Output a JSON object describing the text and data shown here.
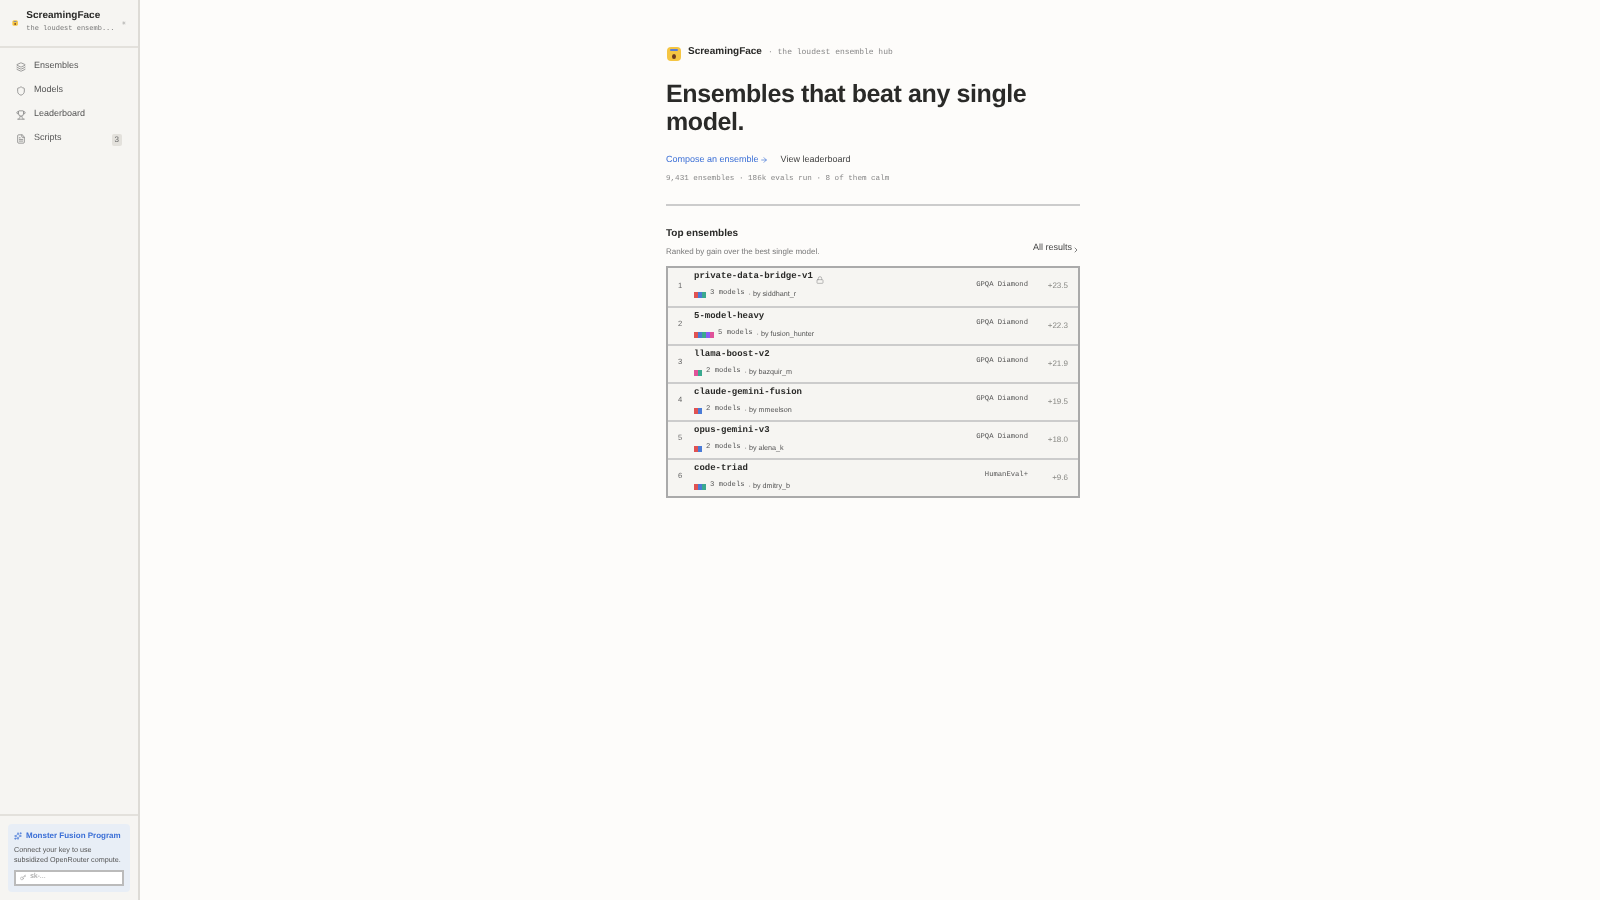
{
  "sidebar": {
    "brand": "ScreamingFace",
    "tagline": "the loudest ensemb...",
    "items": [
      {
        "label": "Ensembles",
        "selected": false
      },
      {
        "label": "Models",
        "selected": false
      },
      {
        "label": "Leaderboard",
        "selected": false
      },
      {
        "label": "Scripts",
        "selected": false,
        "badge": "3"
      }
    ],
    "promo": {
      "title": "Monster Fusion Program",
      "text": "Connect your key to use subsidized OpenRouter compute.",
      "placeholder": "sk-..."
    }
  },
  "header": {
    "brand": "ScreamingFace",
    "tagline": "· the loudest ensemble hub"
  },
  "hero": {
    "title": "Ensembles that beat any single model.",
    "primary_link": "Compose an ensemble",
    "secondary_link": "View leaderboard",
    "stats": "9,431 ensembles · 186k evals run · 8 of them calm"
  },
  "top": {
    "title": "Top ensembles",
    "subtitle": "Ranked by gain over the best single model.",
    "all_link": "All results",
    "rows": [
      {
        "rank": "1",
        "name": "private-data-bridge-v1",
        "locked": true,
        "models": "3 models",
        "author": "· by siddhant_r",
        "benchmark": "GPQA Diamond",
        "gain": "+23.5",
        "swatches": [
          {
            "color": "#e05252"
          },
          {
            "color": "#4a7bd6"
          },
          {
            "color": "#3aa98f"
          }
        ]
      },
      {
        "rank": "2",
        "name": "5-model-heavy",
        "locked": false,
        "models": "5 models",
        "author": "· by fusion_hunter",
        "benchmark": "GPQA Diamond",
        "gain": "+22.3",
        "swatches": [
          {
            "color": "#e05252"
          },
          {
            "color": "#4a7bd6"
          },
          {
            "color": "#3aa98f"
          },
          {
            "color": "#8b5cf6"
          },
          {
            "color": "#e05299"
          }
        ]
      },
      {
        "rank": "3",
        "name": "llama-boost-v2",
        "locked": false,
        "models": "2 models",
        "author": "· by bazquir_m",
        "benchmark": "GPQA Diamond",
        "gain": "+21.9",
        "swatches": [
          {
            "color": "#e05299"
          },
          {
            "color": "#3aa98f"
          }
        ]
      },
      {
        "rank": "4",
        "name": "claude-gemini-fusion",
        "locked": false,
        "models": "2 models",
        "author": "· by mmeelson",
        "benchmark": "GPQA Diamond",
        "gain": "+19.5",
        "swatches": [
          {
            "color": "#e05252"
          },
          {
            "color": "#4a7bd6"
          }
        ]
      },
      {
        "rank": "5",
        "name": "opus-gemini-v3",
        "locked": false,
        "models": "2 models",
        "author": "· by alena_k",
        "benchmark": "GPQA Diamond",
        "gain": "+18.0",
        "swatches": [
          {
            "color": "#e05252"
          },
          {
            "color": "#4a7bd6"
          }
        ]
      },
      {
        "rank": "6",
        "name": "code-triad",
        "locked": false,
        "models": "3 models",
        "author": "· by dmitry_b",
        "benchmark": "HumanEval+",
        "gain": "+9.6",
        "swatches": [
          {
            "color": "#e05252"
          },
          {
            "color": "#4a7bd6"
          },
          {
            "color": "#3aa98f"
          }
        ]
      }
    ]
  }
}
